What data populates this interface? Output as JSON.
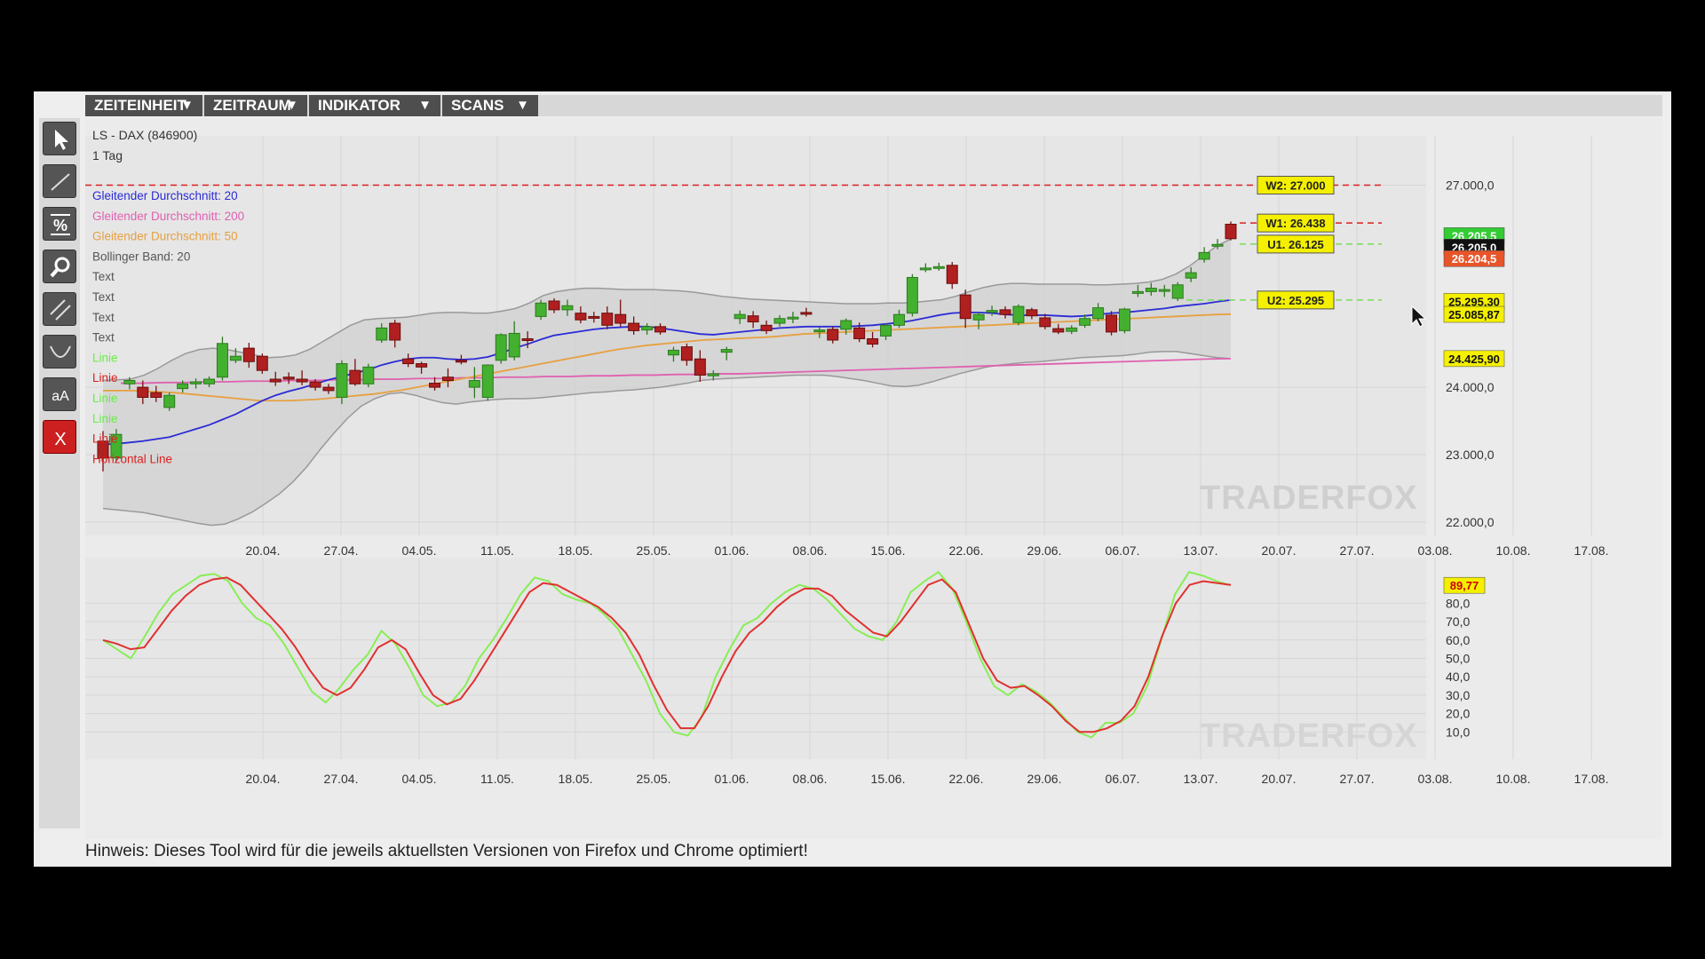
{
  "menu": [
    {
      "label": "ZEITEINHEIT",
      "caret": "▼"
    },
    {
      "label": "ZEITRAUM",
      "caret": "▼"
    },
    {
      "label": "INDIKATOR",
      "caret": "▼"
    },
    {
      "label": "SCANS",
      "caret": "▼"
    }
  ],
  "tools": [
    "cursor-arrow-icon",
    "line-tool-icon",
    "percent-tool-icon",
    "zoom-icon",
    "parallel-lines-icon",
    "curve-tool-icon",
    "text-tool-icon",
    "delete-icon"
  ],
  "tool_labels": {
    "percent": "%",
    "text": "aA",
    "delete": "X"
  },
  "instrument": {
    "name": "LS - DAX (846900)",
    "timeframe": "1 Tag"
  },
  "legend": [
    {
      "text": "Gleitender Durchschnitt: 20",
      "color": "#2b2bd6"
    },
    {
      "text": "Gleitender Durchschnitt: 200",
      "color": "#e060b0"
    },
    {
      "text": "Gleitender Durchschnitt: 50",
      "color": "#e7a040"
    },
    {
      "text": "Bollinger Band: 20",
      "color": "#555555"
    },
    {
      "text": "Text",
      "color": "#555555"
    },
    {
      "text": "Text",
      "color": "#555555"
    },
    {
      "text": "Text",
      "color": "#555555"
    },
    {
      "text": "Text",
      "color": "#555555"
    },
    {
      "text": "Linie",
      "color": "#66ee44"
    },
    {
      "text": "Linie",
      "color": "#dd2020"
    },
    {
      "text": "Linie",
      "color": "#66ee44"
    },
    {
      "text": "Linie",
      "color": "#66ee44"
    },
    {
      "text": "Linie",
      "color": "#dd2020"
    },
    {
      "text": "Horizontal Line",
      "color": "#dd2020"
    }
  ],
  "price_labels": [
    {
      "text": "W2: 27.000",
      "value": 27000
    },
    {
      "text": "W1: 26.438",
      "value": 26438
    },
    {
      "text": "U1. 26.125",
      "value": 26125
    },
    {
      "text": "U2: 25.295",
      "value": 25295
    }
  ],
  "price_badges": [
    {
      "text": "26.205,5",
      "value": 26250,
      "bg": "#33cc33",
      "fg": "#ffffff"
    },
    {
      "text": "26.205,0",
      "value": 26080,
      "bg": "#111111",
      "fg": "#ffffff"
    },
    {
      "text": "26.204,5",
      "value": 25910,
      "bg": "#e8552a",
      "fg": "#ffffff"
    },
    {
      "text": "25.295,30",
      "value": 25275,
      "bg": "#f4f000",
      "fg": "#111111"
    },
    {
      "text": "25.085,87",
      "value": 25082,
      "bg": "#f4f000",
      "fg": "#111111"
    },
    {
      "text": "24.425,90",
      "value": 24425,
      "bg": "#f4f000",
      "fg": "#111111"
    }
  ],
  "stoch_badges": [
    {
      "text": "89,77",
      "value": 89.77,
      "bg": "#f4f000",
      "fg": "#cc0000"
    }
  ],
  "watermark": "TRADERFOX",
  "footer": "Hinweis: Dieses Tool wird für die jeweils aktuellsten Versionen von Firefox und Chrome optimiert!",
  "colors": {
    "bull": "#44b030",
    "bear": "#b02020",
    "sma20": "#2b2bd6",
    "sma50": "#e7a040",
    "sma200": "#e060b0",
    "bollinger": "#999999",
    "stoch_k": "#88ee55",
    "stoch_d": "#e03030",
    "horizontal": "#dd2020"
  },
  "chart_data": {
    "type": "candlestick",
    "instrument": "LS - DAX (846900)",
    "timeframe": "1 Tag",
    "price_axis": {
      "ticks": [
        {
          "value": 22000,
          "label": "22.000,0"
        },
        {
          "value": 23000,
          "label": "23.000,0"
        },
        {
          "value": 24000,
          "label": "24.000,0"
        },
        {
          "value": 27000,
          "label": "27.000,0"
        }
      ],
      "ylim": [
        21800,
        27600
      ]
    },
    "date_ticks": [
      "20.04.",
      "27.04.",
      "04.05.",
      "11.05.",
      "18.05.",
      "25.05.",
      "01.06.",
      "08.06.",
      "15.06.",
      "22.06.",
      "29.06.",
      "06.07.",
      "13.07.",
      "20.07.",
      "27.07.",
      "03.08.",
      "10.08.",
      "17.08."
    ],
    "candles": [
      {
        "o": 23200,
        "h": 23350,
        "l": 22750,
        "c": 22950
      },
      {
        "o": 22950,
        "h": 23380,
        "l": 22900,
        "c": 23300
      },
      {
        "o": 24050,
        "h": 24150,
        "l": 23970,
        "c": 24100
      },
      {
        "o": 24000,
        "h": 24100,
        "l": 23750,
        "c": 23850
      },
      {
        "o": 23920,
        "h": 24020,
        "l": 23780,
        "c": 23850
      },
      {
        "o": 23700,
        "h": 23920,
        "l": 23650,
        "c": 23880
      },
      {
        "o": 23980,
        "h": 24100,
        "l": 23920,
        "c": 24050
      },
      {
        "o": 24050,
        "h": 24130,
        "l": 23980,
        "c": 24080
      },
      {
        "o": 24050,
        "h": 24160,
        "l": 24000,
        "c": 24120
      },
      {
        "o": 24150,
        "h": 24750,
        "l": 24100,
        "c": 24650
      },
      {
        "o": 24400,
        "h": 24580,
        "l": 24360,
        "c": 24460
      },
      {
        "o": 24580,
        "h": 24660,
        "l": 24290,
        "c": 24380
      },
      {
        "o": 24460,
        "h": 24500,
        "l": 24200,
        "c": 24250
      },
      {
        "o": 24120,
        "h": 24230,
        "l": 24020,
        "c": 24080
      },
      {
        "o": 24150,
        "h": 24220,
        "l": 24050,
        "c": 24120
      },
      {
        "o": 24120,
        "h": 24250,
        "l": 24030,
        "c": 24080
      },
      {
        "o": 24080,
        "h": 24120,
        "l": 23950,
        "c": 24000
      },
      {
        "o": 24000,
        "h": 24050,
        "l": 23900,
        "c": 23950
      },
      {
        "o": 23850,
        "h": 24400,
        "l": 23750,
        "c": 24350
      },
      {
        "o": 24250,
        "h": 24420,
        "l": 24020,
        "c": 24050
      },
      {
        "o": 24050,
        "h": 24350,
        "l": 24000,
        "c": 24300
      },
      {
        "o": 24700,
        "h": 24950,
        "l": 24660,
        "c": 24880
      },
      {
        "o": 24950,
        "h": 25000,
        "l": 24590,
        "c": 24700
      },
      {
        "o": 24420,
        "h": 24500,
        "l": 24300,
        "c": 24350
      },
      {
        "o": 24350,
        "h": 24380,
        "l": 24200,
        "c": 24300
      },
      {
        "o": 24060,
        "h": 24150,
        "l": 23950,
        "c": 24000
      },
      {
        "o": 24150,
        "h": 24280,
        "l": 24000,
        "c": 24100
      },
      {
        "o": 24400,
        "h": 24480,
        "l": 24340,
        "c": 24380
      },
      {
        "o": 24000,
        "h": 24300,
        "l": 23840,
        "c": 24100
      },
      {
        "o": 23850,
        "h": 24340,
        "l": 23800,
        "c": 24330
      },
      {
        "o": 24400,
        "h": 24800,
        "l": 24350,
        "c": 24780
      },
      {
        "o": 24450,
        "h": 24980,
        "l": 24400,
        "c": 24800
      },
      {
        "o": 24720,
        "h": 24830,
        "l": 24580,
        "c": 24700
      },
      {
        "o": 25050,
        "h": 25300,
        "l": 25000,
        "c": 25250
      },
      {
        "o": 25280,
        "h": 25320,
        "l": 25100,
        "c": 25150
      },
      {
        "o": 25150,
        "h": 25300,
        "l": 25060,
        "c": 25210
      },
      {
        "o": 25100,
        "h": 25200,
        "l": 24950,
        "c": 25000
      },
      {
        "o": 25050,
        "h": 25120,
        "l": 24960,
        "c": 25030
      },
      {
        "o": 25100,
        "h": 25200,
        "l": 24860,
        "c": 24920
      },
      {
        "o": 25080,
        "h": 25300,
        "l": 24900,
        "c": 24950
      },
      {
        "o": 24950,
        "h": 25050,
        "l": 24780,
        "c": 24840
      },
      {
        "o": 24850,
        "h": 24950,
        "l": 24780,
        "c": 24900
      },
      {
        "o": 24900,
        "h": 24950,
        "l": 24780,
        "c": 24820
      },
      {
        "o": 24480,
        "h": 24600,
        "l": 24380,
        "c": 24550
      },
      {
        "o": 24600,
        "h": 24650,
        "l": 24320,
        "c": 24400
      },
      {
        "o": 24420,
        "h": 24550,
        "l": 24080,
        "c": 24180
      },
      {
        "o": 24170,
        "h": 24250,
        "l": 24100,
        "c": 24200
      },
      {
        "o": 24520,
        "h": 24600,
        "l": 24400,
        "c": 24560
      },
      {
        "o": 25020,
        "h": 25140,
        "l": 24940,
        "c": 25080
      },
      {
        "o": 25060,
        "h": 25130,
        "l": 24880,
        "c": 24970
      },
      {
        "o": 24920,
        "h": 24990,
        "l": 24790,
        "c": 24840
      },
      {
        "o": 24950,
        "h": 25070,
        "l": 24900,
        "c": 25020
      },
      {
        "o": 25030,
        "h": 25120,
        "l": 24950,
        "c": 25040
      },
      {
        "o": 25110,
        "h": 25180,
        "l": 25050,
        "c": 25100
      },
      {
        "o": 24830,
        "h": 24890,
        "l": 24730,
        "c": 24850
      },
      {
        "o": 24860,
        "h": 24900,
        "l": 24650,
        "c": 24700
      },
      {
        "o": 24860,
        "h": 25020,
        "l": 24780,
        "c": 24990
      },
      {
        "o": 24880,
        "h": 24960,
        "l": 24670,
        "c": 24720
      },
      {
        "o": 24720,
        "h": 24820,
        "l": 24590,
        "c": 24640
      },
      {
        "o": 24760,
        "h": 24950,
        "l": 24700,
        "c": 24920
      },
      {
        "o": 24920,
        "h": 25150,
        "l": 24880,
        "c": 25080
      },
      {
        "o": 25100,
        "h": 25680,
        "l": 25050,
        "c": 25630
      },
      {
        "o": 25760,
        "h": 25840,
        "l": 25710,
        "c": 25770
      },
      {
        "o": 25780,
        "h": 25850,
        "l": 25730,
        "c": 25790
      },
      {
        "o": 25810,
        "h": 25860,
        "l": 25460,
        "c": 25540
      },
      {
        "o": 25370,
        "h": 25450,
        "l": 24880,
        "c": 25020
      },
      {
        "o": 25000,
        "h": 25110,
        "l": 24860,
        "c": 25080
      },
      {
        "o": 25120,
        "h": 25210,
        "l": 25060,
        "c": 25140
      },
      {
        "o": 25150,
        "h": 25200,
        "l": 25020,
        "c": 25080
      },
      {
        "o": 24960,
        "h": 25230,
        "l": 24920,
        "c": 25200
      },
      {
        "o": 25150,
        "h": 25180,
        "l": 25010,
        "c": 25060
      },
      {
        "o": 25030,
        "h": 25090,
        "l": 24860,
        "c": 24900
      },
      {
        "o": 24870,
        "h": 24940,
        "l": 24790,
        "c": 24820
      },
      {
        "o": 24830,
        "h": 24920,
        "l": 24790,
        "c": 24880
      },
      {
        "o": 24920,
        "h": 25080,
        "l": 24880,
        "c": 25020
      },
      {
        "o": 25020,
        "h": 25250,
        "l": 24980,
        "c": 25180
      },
      {
        "o": 25070,
        "h": 25130,
        "l": 24770,
        "c": 24820
      },
      {
        "o": 24840,
        "h": 25180,
        "l": 24800,
        "c": 25160
      },
      {
        "o": 25400,
        "h": 25520,
        "l": 25340,
        "c": 25420
      },
      {
        "o": 25420,
        "h": 25550,
        "l": 25360,
        "c": 25470
      },
      {
        "o": 25440,
        "h": 25520,
        "l": 25340,
        "c": 25450
      },
      {
        "o": 25320,
        "h": 25560,
        "l": 25280,
        "c": 25520
      },
      {
        "o": 25620,
        "h": 25780,
        "l": 25560,
        "c": 25700
      },
      {
        "o": 25900,
        "h": 26080,
        "l": 25850,
        "c": 26000
      },
      {
        "o": 26100,
        "h": 26200,
        "l": 26050,
        "c": 26120
      },
      {
        "o": 26420,
        "h": 26460,
        "l": 26180,
        "c": 26205
      }
    ],
    "sma20": [
      23150,
      23160,
      23180,
      23200,
      23230,
      23260,
      23320,
      23380,
      23440,
      23520,
      23600,
      23700,
      23800,
      23880,
      23940,
      23990,
      24050,
      24110,
      24160,
      24210,
      24260,
      24330,
      24380,
      24420,
      24440,
      24440,
      24420,
      24410,
      24420,
      24450,
      24510,
      24580,
      24640,
      24710,
      24770,
      24800,
      24830,
      24860,
      24880,
      24890,
      24900,
      24900,
      24880,
      24850,
      24820,
      24790,
      24780,
      24800,
      24820,
      24840,
      24860,
      24880,
      24890,
      24900,
      24900,
      24900,
      24900,
      24910,
      24920,
      24940,
      24960,
      24990,
      25030,
      25070,
      25100,
      25110,
      25110,
      25100,
      25080,
      25070,
      25070,
      25070,
      25060,
      25050,
      25060,
      25080,
      25100,
      25110,
      25130,
      25150,
      25170,
      25200,
      25220,
      25240,
      25270,
      25295
    ],
    "sma50": [
      23950,
      23950,
      23950,
      23940,
      23930,
      23920,
      23900,
      23880,
      23860,
      23840,
      23820,
      23800,
      23800,
      23800,
      23810,
      23820,
      23840,
      23860,
      23880,
      23900,
      23930,
      23960,
      24000,
      24040,
      24080,
      24120,
      24160,
      24200,
      24240,
      24280,
      24320,
      24360,
      24400,
      24440,
      24480,
      24520,
      24560,
      24590,
      24620,
      24640,
      24660,
      24680,
      24700,
      24710,
      24720,
      24730,
      24740,
      24750,
      24770,
      24790,
      24800,
      24810,
      24820,
      24830,
      24840,
      24850,
      24860,
      24870,
      24880,
      24890,
      24900,
      24910,
      24920,
      24930,
      24940,
      24950,
      24960,
      24970,
      24980,
      24990,
      25000,
      25010,
      25020,
      25030,
      25040,
      25050,
      25060,
      25070,
      25080,
      25085
    ],
    "sma200": [
      24060,
      24060,
      24070,
      24070,
      24080,
      24080,
      24090,
      24090,
      24100,
      24100,
      24110,
      24110,
      24120,
      24120,
      24130,
      24130,
      24140,
      24140,
      24150,
      24150,
      24160,
      24160,
      24170,
      24170,
      24180,
      24180,
      24190,
      24190,
      24200,
      24200,
      24210,
      24220,
      24230,
      24240,
      24250,
      24260,
      24270,
      24280,
      24290,
      24300,
      24310,
      24320,
      24330,
      24340,
      24350,
      24360,
      24370,
      24380,
      24390,
      24400,
      24410,
      24420,
      24425
    ],
    "bollinger_upper": [
      24100,
      24110,
      24120,
      24180,
      24280,
      24400,
      24500,
      24560,
      24580,
      24560,
      24520,
      24480,
      24440,
      24450,
      24480,
      24560,
      24680,
      24800,
      24920,
      25000,
      25020,
      25030,
      25040,
      25070,
      25100,
      25110,
      25110,
      25100,
      25100,
      25130,
      25170,
      25250,
      25360,
      25420,
      25450,
      25470,
      25470,
      25460,
      25450,
      25450,
      25450,
      25440,
      25430,
      25410,
      25380,
      25350,
      25330,
      25310,
      25300,
      25290,
      25280,
      25270,
      25260,
      25250,
      25240,
      25240,
      25240,
      25250,
      25250,
      25260,
      25280,
      25300,
      25350,
      25420,
      25480,
      25520,
      25540,
      25540,
      25530,
      25530,
      25530,
      25530,
      25520,
      25520,
      25530,
      25540,
      25560,
      25600,
      25680,
      25800,
      25950,
      26100,
      26200
    ],
    "bollinger_lower": [
      22200,
      22180,
      22160,
      22140,
      22100,
      22060,
      22020,
      21980,
      21950,
      21970,
      22050,
      22150,
      22280,
      22420,
      22600,
      22820,
      23080,
      23320,
      23540,
      23720,
      23830,
      23900,
      23920,
      23880,
      23820,
      23770,
      23750,
      23780,
      23800,
      23820,
      23830,
      23830,
      23840,
      23860,
      23880,
      23900,
      23920,
      23930,
      23950,
      23960,
      23980,
      24000,
      24030,
      24060,
      24100,
      24120,
      24130,
      24140,
      24150,
      24160,
      24170,
      24180,
      24180,
      24180,
      24160,
      24130,
      24100,
      24060,
      24020,
      24010,
      24030,
      24080,
      24140,
      24200,
      24250,
      24300,
      24330,
      24350,
      24370,
      24380,
      24400,
      24420,
      24440,
      24450,
      24460,
      24470,
      24490,
      24520,
      24530,
      24530,
      24500,
      24470,
      24440,
      24425
    ],
    "stochastic": {
      "ylim": [
        0,
        100
      ],
      "ticks": [
        {
          "value": 10,
          "label": "10,0"
        },
        {
          "value": 20,
          "label": "20,0"
        },
        {
          "value": 30,
          "label": "30,0"
        },
        {
          "value": 40,
          "label": "40,0"
        },
        {
          "value": 50,
          "label": "50,0"
        },
        {
          "value": 60,
          "label": "60,0"
        },
        {
          "value": 70,
          "label": "70,0"
        },
        {
          "value": 80,
          "label": "80,0"
        }
      ],
      "k": [
        60,
        55,
        50,
        62,
        75,
        85,
        90,
        95,
        96,
        92,
        80,
        72,
        68,
        58,
        45,
        32,
        26,
        34,
        44,
        52,
        65,
        58,
        45,
        30,
        24,
        26,
        35,
        50,
        60,
        72,
        85,
        94,
        92,
        85,
        82,
        80,
        74,
        66,
        52,
        38,
        20,
        10,
        8,
        18,
        40,
        55,
        68,
        72,
        80,
        86,
        90,
        88,
        82,
        74,
        66,
        62,
        60,
        70,
        86,
        92,
        97,
        88,
        70,
        50,
        35,
        30,
        36,
        32,
        26,
        18,
        10,
        7,
        15,
        15,
        20,
        35,
        60,
        85,
        97,
        95,
        92,
        89.77
      ],
      "d": [
        60,
        58,
        55,
        56,
        66,
        76,
        84,
        90,
        93,
        94,
        90,
        82,
        74,
        66,
        56,
        44,
        34,
        30,
        34,
        44,
        56,
        60,
        55,
        42,
        30,
        25,
        28,
        38,
        50,
        62,
        74,
        86,
        91,
        90,
        86,
        82,
        78,
        72,
        64,
        52,
        36,
        22,
        12,
        12,
        24,
        40,
        54,
        64,
        70,
        78,
        84,
        88,
        88,
        84,
        76,
        70,
        64,
        62,
        70,
        80,
        90,
        93,
        86,
        68,
        50,
        38,
        34,
        35,
        30,
        24,
        16,
        10,
        10,
        12,
        16,
        24,
        40,
        62,
        80,
        90,
        92,
        91,
        90
      ]
    }
  }
}
